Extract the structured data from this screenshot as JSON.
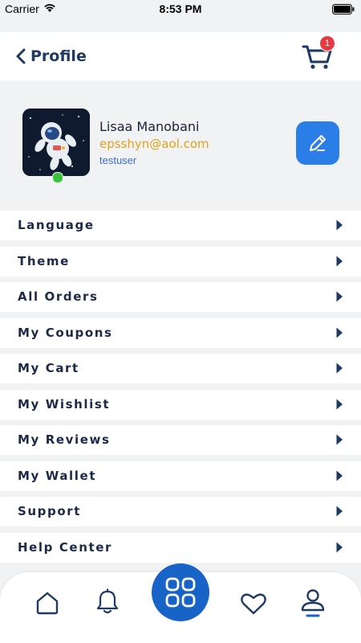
{
  "status_bar": {
    "carrier": "Carrier",
    "time": "8:53 PM"
  },
  "header": {
    "title": "Profile",
    "cart_count": "1"
  },
  "profile": {
    "name": "Lisaa Manobani",
    "email": "epsshyn@aol.com",
    "username": "testuser",
    "online": true
  },
  "menu": [
    {
      "label": "Language"
    },
    {
      "label": "Theme"
    },
    {
      "label": "All Orders"
    },
    {
      "label": "My Coupons"
    },
    {
      "label": "My Cart"
    },
    {
      "label": "My Wishlist"
    },
    {
      "label": "My Reviews"
    },
    {
      "label": "My Wallet"
    },
    {
      "label": "Support"
    },
    {
      "label": "Help Center"
    }
  ],
  "bottom_nav": {
    "items": [
      "home-icon",
      "bell-icon",
      "grid-icon",
      "heart-icon",
      "profile-icon"
    ],
    "active": "profile-icon"
  },
  "colors": {
    "accent_blue": "#1763c8",
    "edit_blue": "#2b7ee8",
    "email_gold": "#e2a21c",
    "badge_red": "#e9383f",
    "online_green": "#3cc13b",
    "text_navy": "#1c2a48"
  }
}
